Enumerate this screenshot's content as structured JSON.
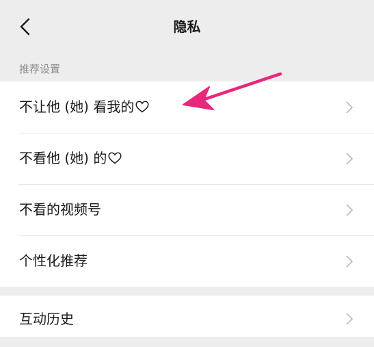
{
  "header": {
    "back_icon": "chevron-left-icon",
    "title": "隐私"
  },
  "section": {
    "label": "推荐设置"
  },
  "rows": [
    {
      "label": "不让他 (她) 看我的",
      "icon": "heart-icon"
    },
    {
      "label": "不看他 (她) 的",
      "icon": "heart-icon"
    },
    {
      "label": "不看的视频号"
    },
    {
      "label": "个性化推荐"
    }
  ],
  "rows2": [
    {
      "label": "互动历史"
    }
  ],
  "colors": {
    "background": "#ededed",
    "row_background": "#ffffff",
    "annotation_arrow": "#e8287a"
  }
}
